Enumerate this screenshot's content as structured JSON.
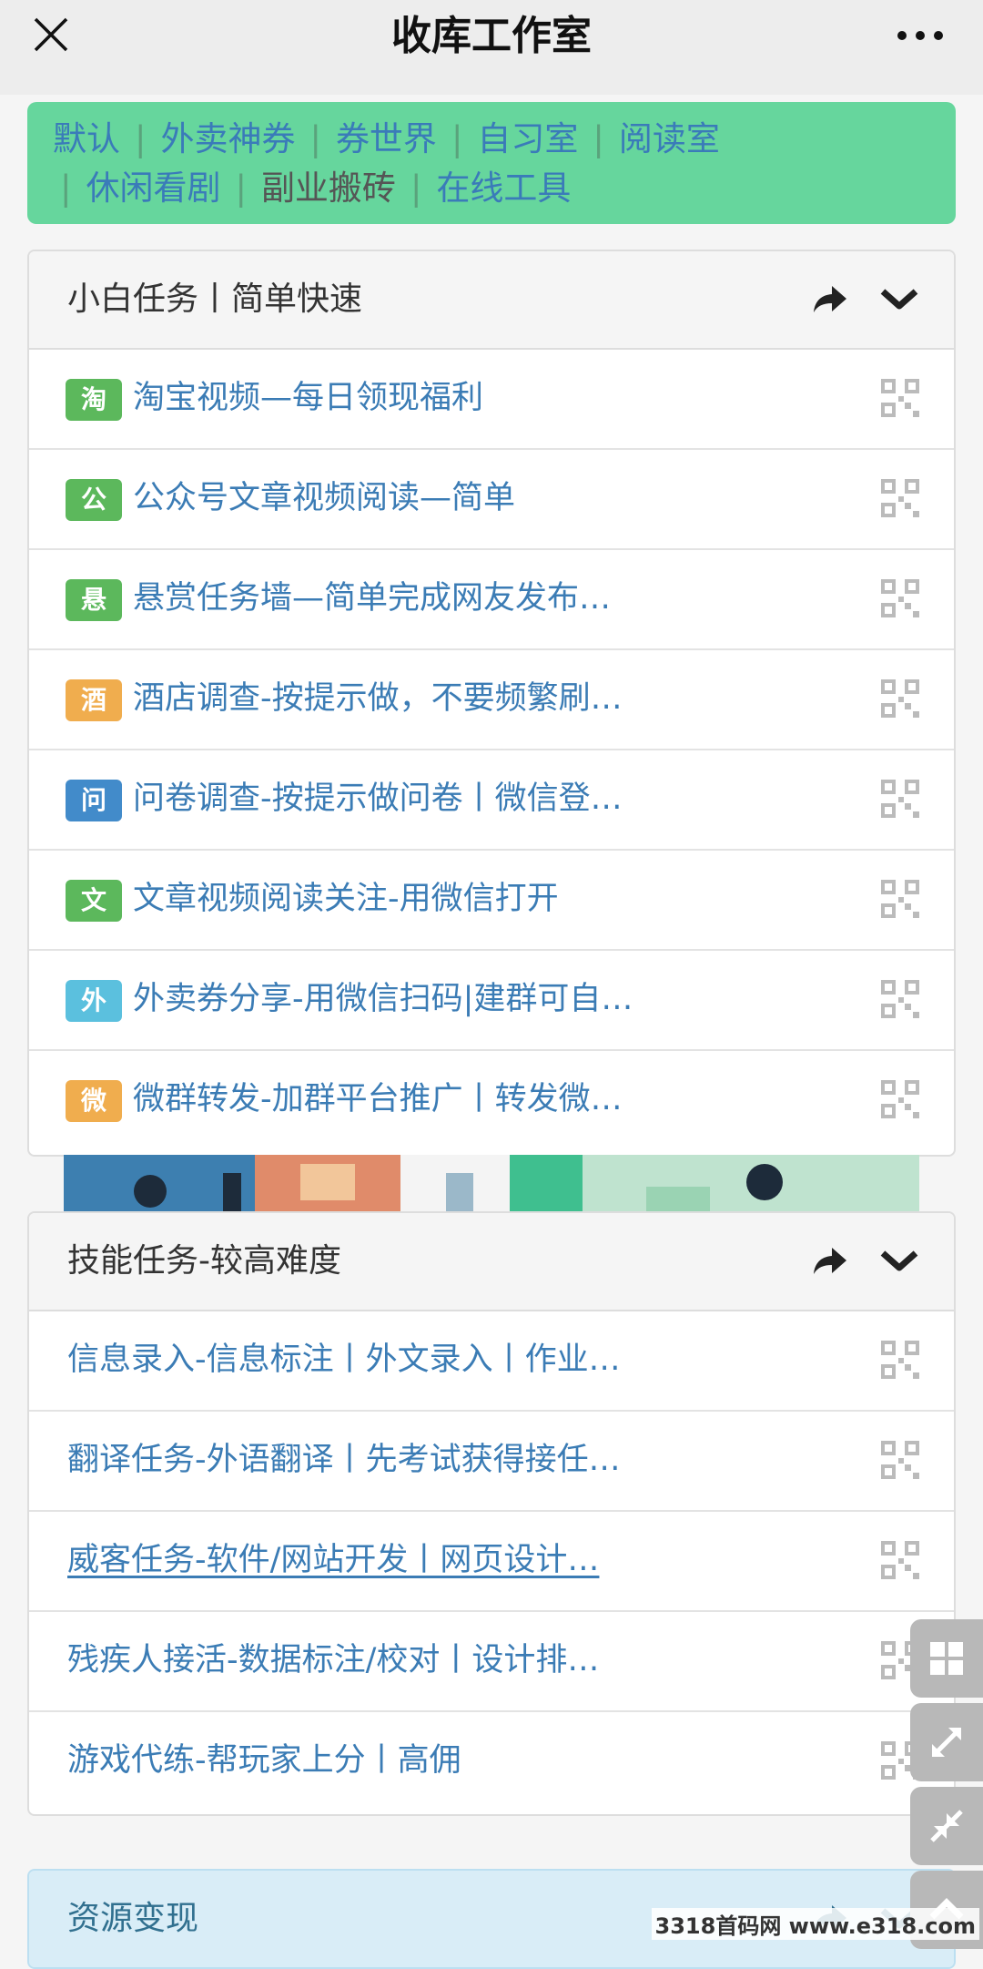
{
  "header": {
    "title": "收库工作室"
  },
  "categories": [
    {
      "label": "默认"
    },
    {
      "label": "外卖神券"
    },
    {
      "label": "券世界"
    },
    {
      "label": "自习室"
    },
    {
      "label": "阅读室"
    },
    {
      "label": "休闲看剧"
    },
    {
      "label": "副业搬砖"
    },
    {
      "label": "在线工具"
    }
  ],
  "panel1": {
    "title": "小白任务丨简单快速",
    "rows": [
      {
        "badge": "淘",
        "badge_color": "#5cb85c",
        "text": "淘宝视频—每日领现福利"
      },
      {
        "badge": "公",
        "badge_color": "#5cb85c",
        "text": "公众号文章视频阅读—简单"
      },
      {
        "badge": "悬",
        "badge_color": "#5cb85c",
        "text": "悬赏任务墙—简单完成网友发布…"
      },
      {
        "badge": "酒",
        "badge_color": "#f0ad4e",
        "text": "酒店调查-按提示做，不要频繁刷…"
      },
      {
        "badge": "问",
        "badge_color": "#428bca",
        "text": "问卷调查-按提示做问卷丨微信登…"
      },
      {
        "badge": "文",
        "badge_color": "#5cb85c",
        "text": "文章视频阅读关注-用微信打开"
      },
      {
        "badge": "外",
        "badge_color": "#5bc0de",
        "text": "外卖券分享-用微信扫码|建群可自…"
      },
      {
        "badge": "微",
        "badge_color": "#f0ad4e",
        "text": "微群转发-加群平台推广丨转发微…"
      }
    ]
  },
  "panel2": {
    "title": "技能任务-较高难度",
    "rows": [
      {
        "text": "信息录入-信息标注丨外文录入丨作业…"
      },
      {
        "text": "翻译任务-外语翻译丨先考试获得接任…"
      },
      {
        "text": "威客任务-软件/网站开发丨网页设计…"
      },
      {
        "text": "残疾人接活-数据标注/校对丨设计排…"
      },
      {
        "text": "游戏代练-帮玩家上分丨高佣"
      }
    ]
  },
  "panel3": {
    "title": "资源变现"
  },
  "watermark": "3318首码网 www.e318.com",
  "colors": {
    "accent_green": "#66d69d",
    "link_blue": "#3b7cb5",
    "panel3_header": "#d9edf7"
  },
  "icons": [
    "close-icon",
    "more-icon",
    "share-icon",
    "chevron-down-icon",
    "qr-code-icon",
    "grid-icon",
    "expand-icon",
    "collapse-icon",
    "chevron-up-icon"
  ]
}
